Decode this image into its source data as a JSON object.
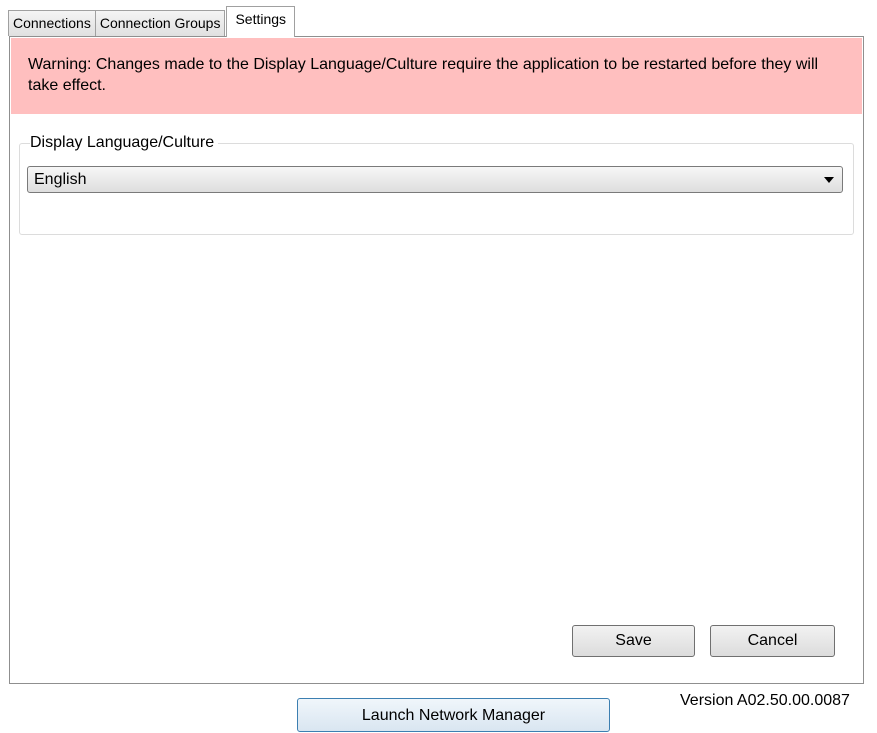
{
  "tabs": [
    {
      "label": "Connections",
      "active": false
    },
    {
      "label": "Connection Groups",
      "active": false
    },
    {
      "label": "Settings",
      "active": true
    }
  ],
  "settings": {
    "warning_text": "Warning: Changes made to the Display Language/Culture require the application to be restarted before they will take effect.",
    "warning_color": "#ffbfbf",
    "language_group_label": "Display Language/Culture",
    "language_selected": "English",
    "save_label": "Save",
    "cancel_label": "Cancel"
  },
  "footer": {
    "launch_button_label": "Launch Network Manager",
    "version_text": "Version A02.50.00.0087"
  },
  "icons": {
    "dropdown": "chevron-down-icon"
  }
}
